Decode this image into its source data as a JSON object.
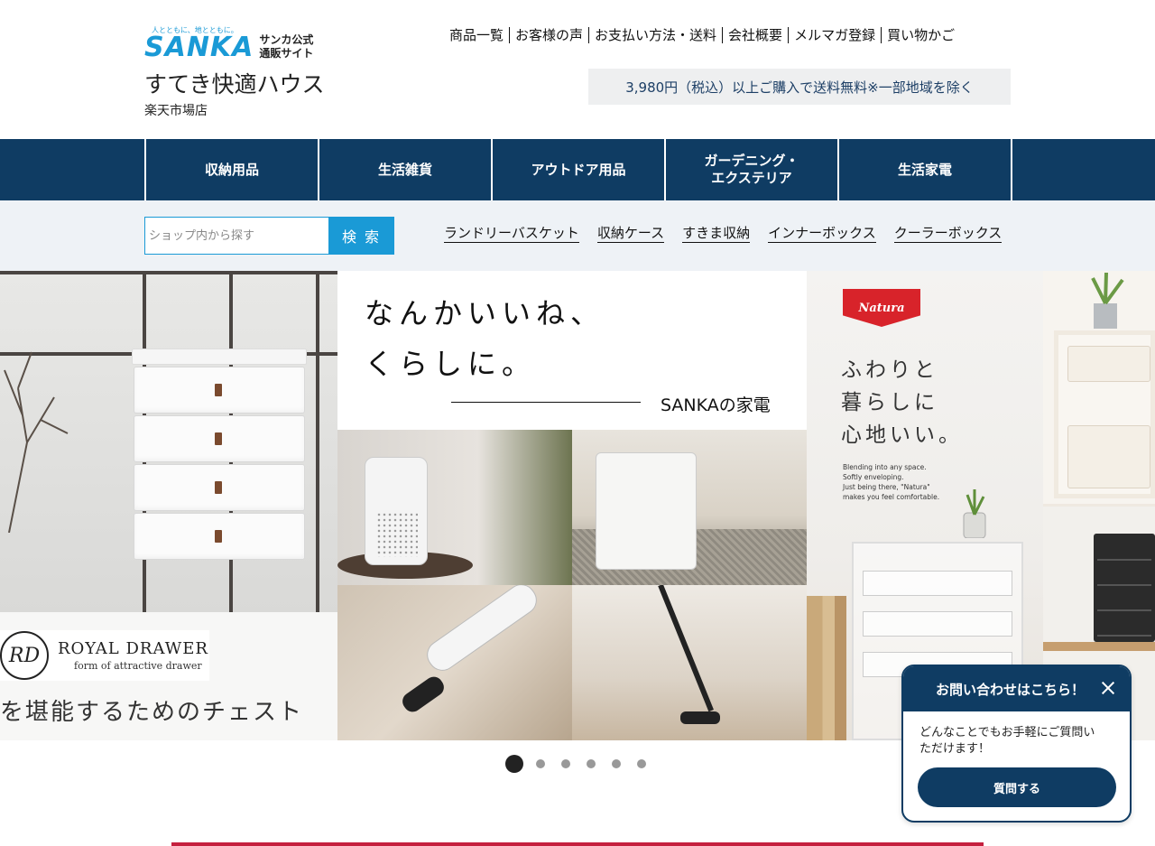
{
  "logo": {
    "tagline": "人とともに、地とともに。",
    "brand": "SANKA",
    "sub": "サンカ公式\n通販サイト",
    "shop_name": "すてき快適ハウス",
    "shop_sub": "楽天市場店"
  },
  "top_links": [
    "商品一覧",
    "お客様の声",
    "お支払い方法・送料",
    "会社概要",
    "メルマガ登録",
    "買い物かご"
  ],
  "free_shipping": "3,980円（税込）以上ご購入で送料無料※一部地域を除く",
  "main_nav": [
    "収納用品",
    "生活雑貨",
    "アウトドア用品",
    "ガーデニング・\nエクステリア",
    "生活家電"
  ],
  "search": {
    "placeholder": "ショップ内から探す",
    "button": "検 索"
  },
  "quick_links": [
    "ランドリーバスケット",
    "収納ケース",
    "すきま収納",
    "インナーボックス",
    "クーラーボックス"
  ],
  "slides": {
    "royal": {
      "logo_mark": "RD",
      "title": "ROYAL DRAWER",
      "subtitle": "form of attractive drawer",
      "caption": "を堪能するためのチェスト"
    },
    "appliance": {
      "line1": "なんかいいね、",
      "line2": "くらしに。",
      "brand": "SANKAの家電"
    },
    "natura": {
      "badge": "Natura",
      "headline": "ふわりと\n暮らしに\n心地いい。",
      "english": "Blending into any space.\nSoftly enveloping.\nJust  being  there,  \"Natura\"\nmakes you feel comfortable."
    }
  },
  "carousel": {
    "slide_count": 6,
    "active_index": 0
  },
  "chat": {
    "title": "お問い合わせはこちら！",
    "message": "どんなことでもお手軽にご質問い\nただけます！",
    "button": "質問する"
  },
  "colors": {
    "navy": "#0f3c63",
    "brand_blue": "#1a9ad6",
    "accent_red": "#c5203e",
    "natura_red": "#d8232a"
  }
}
